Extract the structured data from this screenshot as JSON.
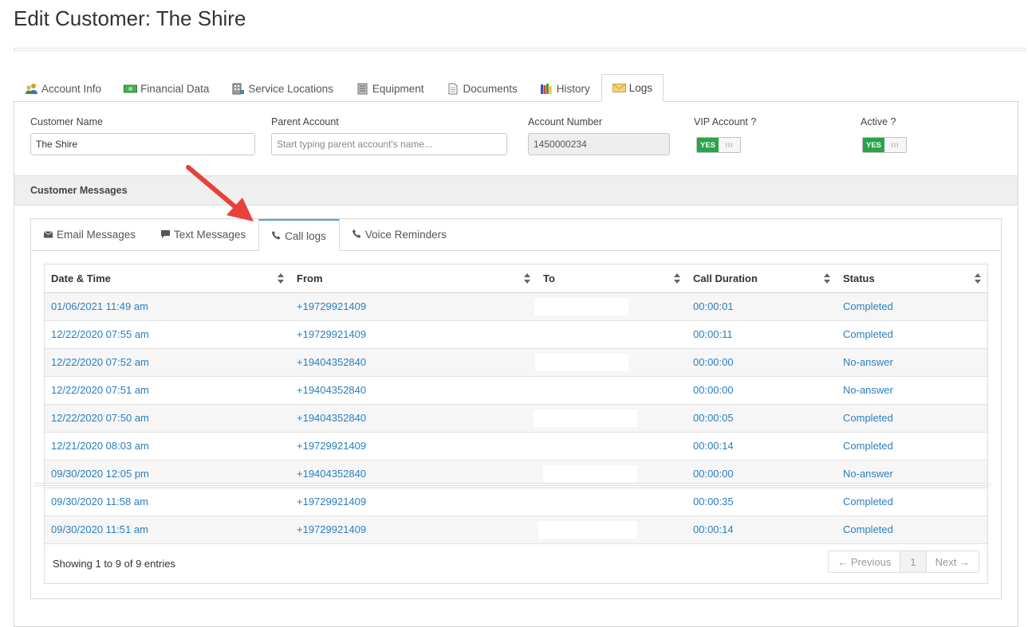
{
  "page": {
    "title": "Edit Customer: The Shire"
  },
  "main_tabs": [
    {
      "label": "Account Info",
      "icon": "users-icon"
    },
    {
      "label": "Financial Data",
      "icon": "money-icon"
    },
    {
      "label": "Service Locations",
      "icon": "building-icon"
    },
    {
      "label": "Equipment",
      "icon": "server-icon"
    },
    {
      "label": "Documents",
      "icon": "document-icon"
    },
    {
      "label": "History",
      "icon": "books-icon"
    },
    {
      "label": "Logs",
      "icon": "envelope-icon",
      "active": true
    }
  ],
  "form": {
    "customer_name": {
      "label": "Customer Name",
      "value": "The Shire"
    },
    "parent_account": {
      "label": "Parent Account",
      "value": "",
      "placeholder": "Start typing parent account's name..."
    },
    "account_number": {
      "label": "Account Number",
      "value": "1450000234"
    },
    "vip": {
      "label": "VIP Account ?",
      "state": "YES",
      "handle": "III"
    },
    "active": {
      "label": "Active ?",
      "state": "YES",
      "handle": "III"
    }
  },
  "section": {
    "title": "Customer Messages"
  },
  "sub_tabs": [
    {
      "label": "Email Messages",
      "icon": "envelope-icon"
    },
    {
      "label": "Text Messages",
      "icon": "chat-icon"
    },
    {
      "label": "Call logs",
      "icon": "phone-icon",
      "active": true
    },
    {
      "label": "Voice Reminders",
      "icon": "phone-icon"
    }
  ],
  "table": {
    "columns": [
      "Date & Time",
      "From",
      "To",
      "Call Duration",
      "Status"
    ],
    "rows": [
      {
        "datetime": "01/06/2021 11:49 am",
        "from": "+19729921409",
        "to": "",
        "duration": "00:00:01",
        "status": "Completed"
      },
      {
        "datetime": "12/22/2020 07:55 am",
        "from": "+19729921409",
        "to": "",
        "duration": "00:00:11",
        "status": "Completed"
      },
      {
        "datetime": "12/22/2020 07:52 am",
        "from": "+19404352840",
        "to": "",
        "duration": "00:00:00",
        "status": "No-answer"
      },
      {
        "datetime": "12/22/2020 07:51 am",
        "from": "+19404352840",
        "to": "",
        "duration": "00:00:00",
        "status": "No-answer"
      },
      {
        "datetime": "12/22/2020 07:50 am",
        "from": "+19404352840",
        "to": "",
        "duration": "00:00:05",
        "status": "Completed"
      },
      {
        "datetime": "12/21/2020 08:03 am",
        "from": "+19729921409",
        "to": "",
        "duration": "00:00:14",
        "status": "Completed"
      },
      {
        "datetime": "09/30/2020 12:05 pm",
        "from": "+19404352840",
        "to": "",
        "duration": "00:00:00",
        "status": "No-answer"
      },
      {
        "datetime": "09/30/2020 11:58 am",
        "from": "+19729921409",
        "to": "",
        "duration": "00:00:35",
        "status": "Completed"
      },
      {
        "datetime": "09/30/2020 11:51 am",
        "from": "+19729921409",
        "to": "",
        "duration": "00:00:14",
        "status": "Completed"
      }
    ],
    "info": "Showing 1 to 9 of 9 entries",
    "pager": {
      "previous": "← Previous",
      "current": "1",
      "next": "Next →"
    }
  },
  "colors": {
    "link": "#2a7fc0",
    "toggle_on": "#2aa34a",
    "active_tab_border": "#5aa0d6",
    "annotation_arrow": "#e8413c"
  }
}
